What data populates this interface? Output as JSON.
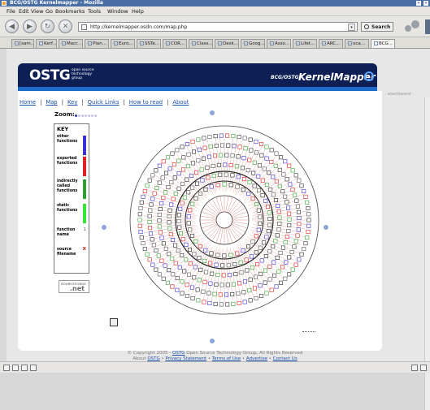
{
  "window": {
    "title": "BCG/OSTG Kernelmapper - Mozilla"
  },
  "menubar": {
    "items": [
      "File",
      "Edit",
      "View",
      "Go",
      "Bookmarks",
      "Tools",
      "Window",
      "Help"
    ]
  },
  "navbar": {
    "url": "http://kernelmapper.osdn.com/map.php",
    "search_label": "Search"
  },
  "tabs": [
    {
      "label": "[sam...",
      "active": false
    },
    {
      "label": "Kerf...",
      "active": false
    },
    {
      "label": "Macr...",
      "active": false
    },
    {
      "label": "Plan...",
      "active": false
    },
    {
      "label": "Euro...",
      "active": false
    },
    {
      "label": "SSTe...",
      "active": false
    },
    {
      "label": "COR...",
      "active": false
    },
    {
      "label": "Class...",
      "active": false
    },
    {
      "label": "Desk...",
      "active": false
    },
    {
      "label": "Goog...",
      "active": false
    },
    {
      "label": "Asso...",
      "active": false
    },
    {
      "label": "Lifet...",
      "active": false
    },
    {
      "label": "ARC...",
      "active": false
    },
    {
      "label": "oca...",
      "active": false
    },
    {
      "label": "BCG...",
      "active": true
    }
  ],
  "banner": {
    "logo": "OSTG",
    "tagline": "open source technology group",
    "bcg": "BCG/OSTG",
    "product": "KernelMapper",
    "ad_label": "- advertisement -"
  },
  "nav_links": [
    "Home",
    "Map",
    "Key",
    "Quick Links",
    "How to read",
    "About"
  ],
  "zoom": {
    "label": "Zoom:",
    "levels": 7,
    "current": 1
  },
  "key": {
    "title": "KEY",
    "items": [
      {
        "label": "other functions",
        "color": "#3a2fd1"
      },
      {
        "label": "exported functions",
        "color": "#e02020"
      },
      {
        "label": "indirectly called functions",
        "color": "#2fa02f"
      },
      {
        "label": "static functions",
        "color": "#33e633"
      }
    ],
    "function_name": "function name",
    "function_glyph": "1",
    "source_filename": "source filename",
    "source_glyph": "x"
  },
  "sourcebox": {
    "line1": "SOURCEFORGE",
    "line2": ".net"
  },
  "colors": {
    "banner_bg": "#0d1f55",
    "banner_stripe": "#1c6ac9",
    "link": "#1b4ea8",
    "map_line": "#b03020",
    "blue_dot": "#8da4d8"
  },
  "footer": {
    "copyright": "© Copyright 2005 - ",
    "ostg": "OSTG",
    "copyright_rest": " Open Source Technology Group, All Rights Reserved",
    "about": "About ",
    "links": [
      "OSTG",
      "Privacy Statement",
      "Terms of Use",
      "Advertise",
      "Contact Us"
    ],
    "sep": " • "
  }
}
